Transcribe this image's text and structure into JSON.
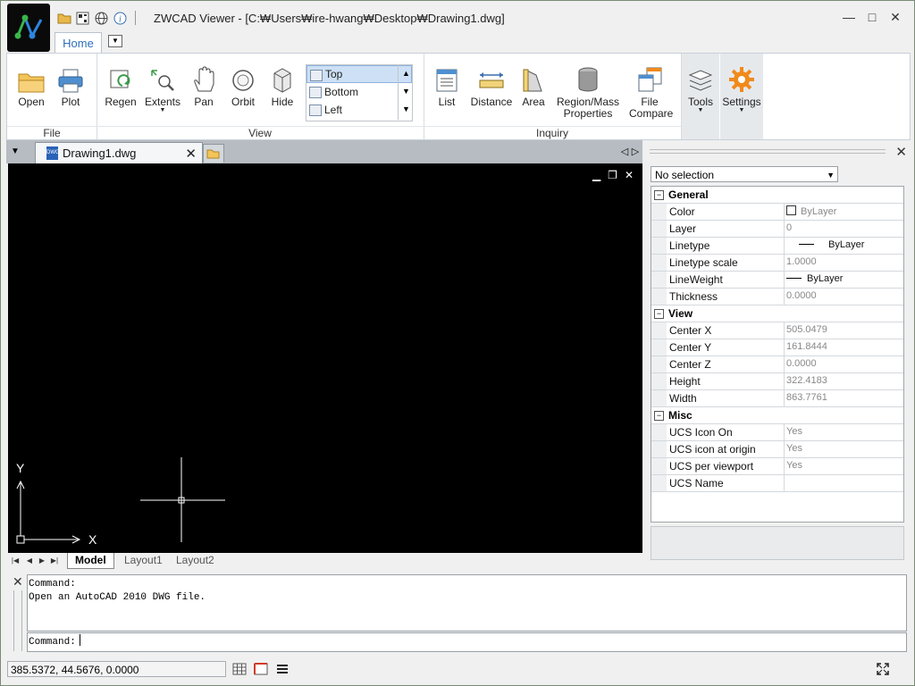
{
  "window": {
    "title": "ZWCAD Viewer - [C:₩Users₩ire-hwang₩Desktop₩Drawing1.dwg]",
    "controls": {
      "minimize": "—",
      "maximize": "□",
      "close": "✕"
    }
  },
  "quick_access": {
    "icons": [
      "open-folder-icon",
      "qr-icon",
      "globe-icon",
      "info-icon"
    ]
  },
  "ribbon": {
    "tabs": [
      {
        "label": "Home",
        "active": true
      }
    ],
    "groups": {
      "file": {
        "label": "File",
        "buttons": {
          "open": "Open",
          "plot": "Plot"
        }
      },
      "view": {
        "label": "View",
        "buttons": {
          "regen": "Regen",
          "extents": "Extents",
          "pan": "Pan",
          "orbit": "Orbit",
          "hide": "Hide"
        },
        "views": [
          "Top",
          "Bottom",
          "Left"
        ],
        "selected_view": "Top"
      },
      "inquiry": {
        "label": "Inquiry",
        "buttons": {
          "list": "List",
          "distance": "Distance",
          "area": "Area",
          "region_line1": "Region/Mass",
          "region_line2": "Properties",
          "file_line1": "File",
          "file_line2": "Compare"
        }
      },
      "tools": {
        "label": "Tools"
      },
      "settings": {
        "label": "Settings"
      }
    }
  },
  "document": {
    "tab_name": "Drawing1.dwg",
    "tab_close": "✕",
    "dwg_badge": "DWG"
  },
  "viewport": {
    "controls": {
      "minimize": "▁",
      "restore": "❐",
      "close": "✕"
    },
    "ucs": {
      "x_label": "X",
      "y_label": "Y"
    }
  },
  "layouts": {
    "tabs": [
      {
        "label": "Model",
        "active": true
      },
      {
        "label": "Layout1",
        "active": false
      },
      {
        "label": "Layout2",
        "active": false
      }
    ]
  },
  "properties": {
    "selection": "No selection",
    "categories": [
      {
        "name": "General",
        "rows": [
          {
            "name": "Color",
            "value": "ByLayer",
            "kind": "color"
          },
          {
            "name": "Layer",
            "value": "0",
            "kind": "text"
          },
          {
            "name": "Linetype",
            "value": "ByLayer",
            "kind": "linetype"
          },
          {
            "name": "Linetype scale",
            "value": "1.0000",
            "kind": "text"
          },
          {
            "name": "LineWeight",
            "value": "ByLayer",
            "kind": "lineweight"
          },
          {
            "name": "Thickness",
            "value": "0.0000",
            "kind": "text"
          }
        ]
      },
      {
        "name": "View",
        "rows": [
          {
            "name": "Center X",
            "value": "505.0479",
            "kind": "text"
          },
          {
            "name": "Center Y",
            "value": "161.8444",
            "kind": "text"
          },
          {
            "name": "Center Z",
            "value": "0.0000",
            "kind": "text"
          },
          {
            "name": "Height",
            "value": "322.4183",
            "kind": "text"
          },
          {
            "name": "Width",
            "value": "863.7761",
            "kind": "text"
          }
        ]
      },
      {
        "name": "Misc",
        "rows": [
          {
            "name": "UCS Icon On",
            "value": "Yes",
            "kind": "text"
          },
          {
            "name": "UCS icon at origin",
            "value": "Yes",
            "kind": "text"
          },
          {
            "name": "UCS per viewport",
            "value": "Yes",
            "kind": "text"
          },
          {
            "name": "UCS Name",
            "value": "",
            "kind": "text"
          }
        ]
      }
    ]
  },
  "command": {
    "history": [
      "Command:",
      "Open an AutoCAD 2010 DWG file."
    ],
    "prompt": "Command:"
  },
  "status": {
    "coordinates": "385.5372, 44.5676, 0.0000"
  },
  "colors": {
    "accent": "#2e6fb9",
    "canvas": "#000000",
    "settings_gear": "#f08a1c"
  }
}
